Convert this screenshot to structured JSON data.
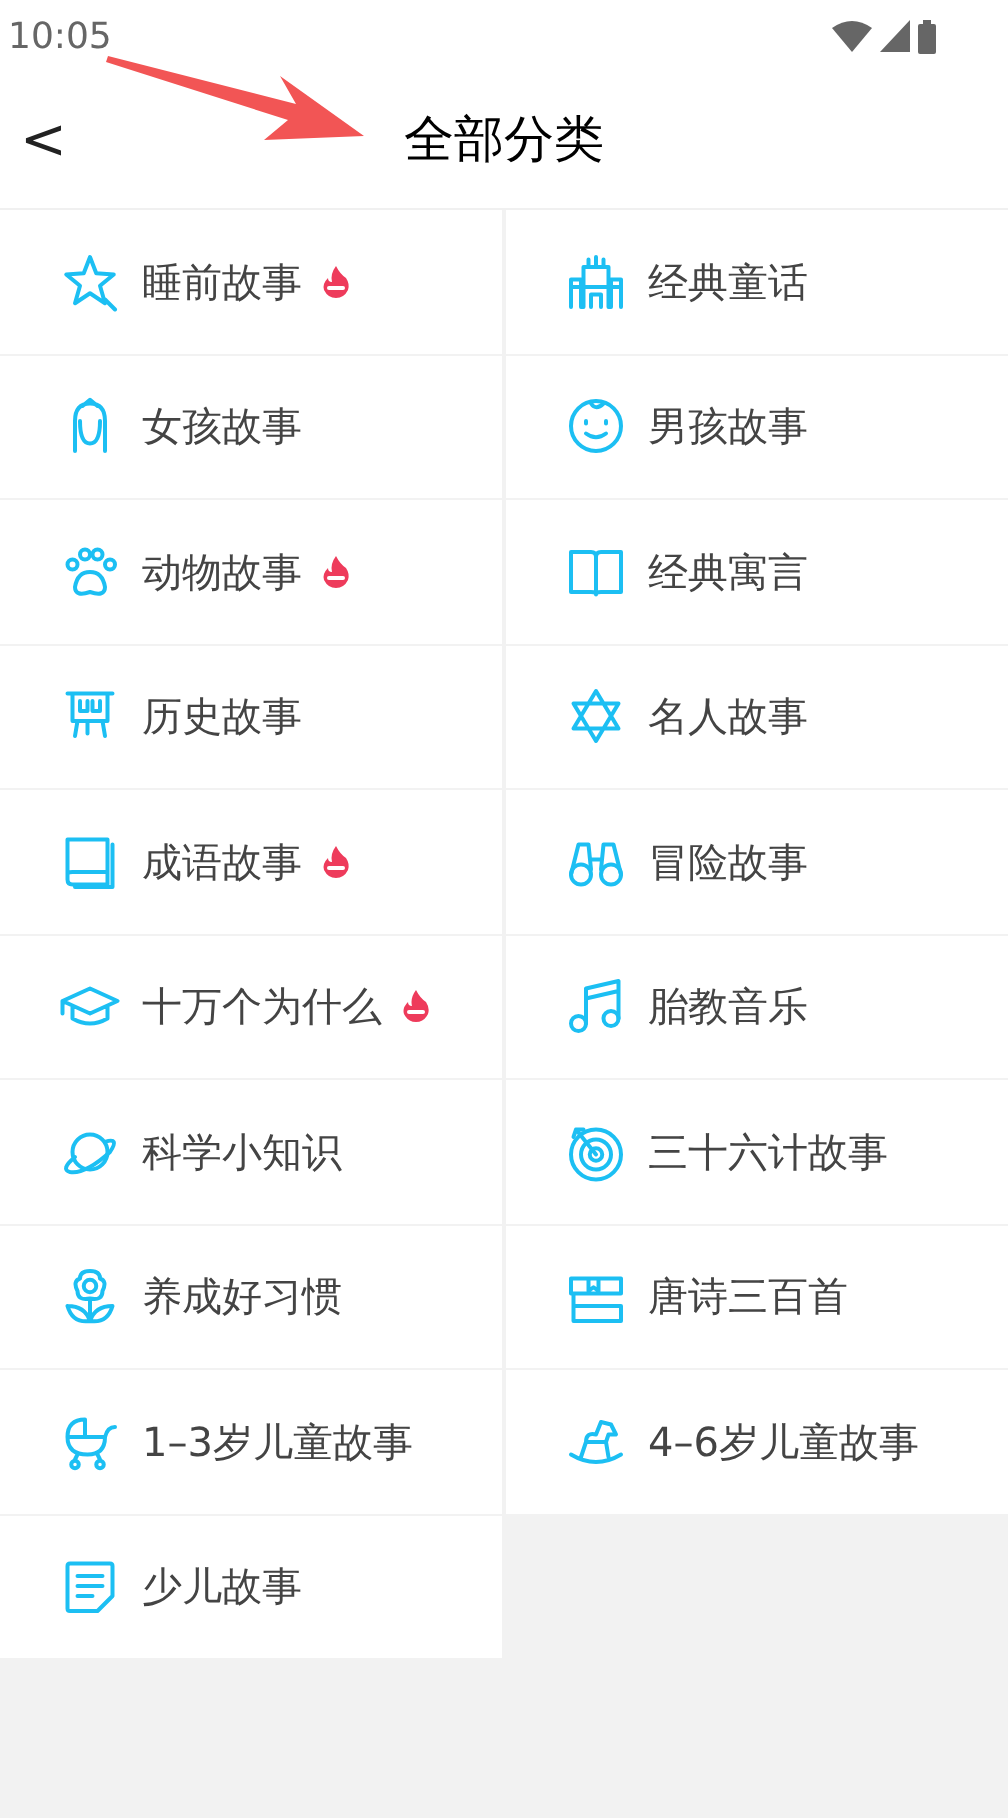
{
  "status_bar": {
    "time": "10:05"
  },
  "title_bar": {
    "back": "<",
    "title": "全部分类"
  },
  "categories": [
    {
      "label": "睡前故事",
      "hot": true
    },
    {
      "label": "经典童话",
      "hot": false
    },
    {
      "label": "女孩故事",
      "hot": false
    },
    {
      "label": "男孩故事",
      "hot": false
    },
    {
      "label": "动物故事",
      "hot": true
    },
    {
      "label": "经典寓言",
      "hot": false
    },
    {
      "label": "历史故事",
      "hot": false
    },
    {
      "label": "名人故事",
      "hot": false
    },
    {
      "label": "成语故事",
      "hot": true
    },
    {
      "label": "冒险故事",
      "hot": false
    },
    {
      "label": "十万个为什么",
      "hot": true
    },
    {
      "label": "胎教音乐",
      "hot": false
    },
    {
      "label": "科学小知识",
      "hot": false
    },
    {
      "label": "三十六计故事",
      "hot": false
    },
    {
      "label": "养成好习惯",
      "hot": false
    },
    {
      "label": "唐诗三百首",
      "hot": false
    },
    {
      "label": "1–3岁儿童故事",
      "hot": false
    },
    {
      "label": "4–6岁儿童故事",
      "hot": false
    },
    {
      "label": "少儿故事",
      "hot": false
    }
  ]
}
